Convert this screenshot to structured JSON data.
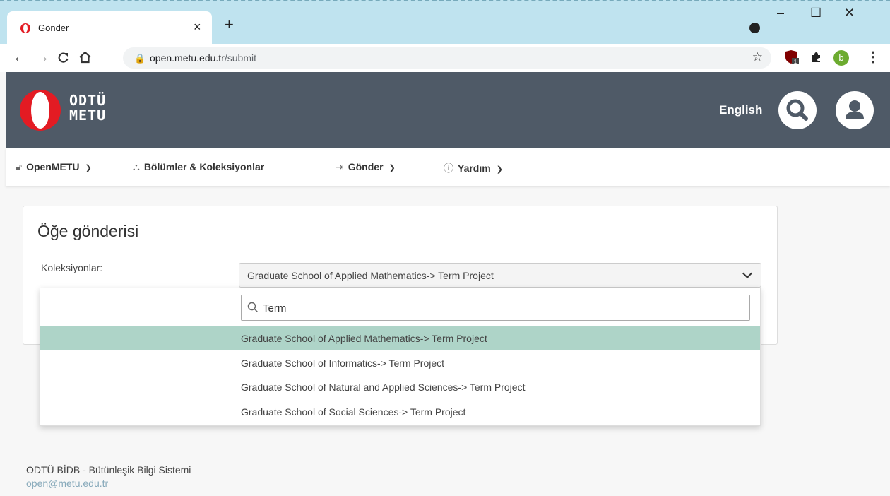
{
  "browser": {
    "tab_title": "Gönder",
    "tab_close": "×",
    "new_tab": "+",
    "url_host": "open.metu.edu.tr",
    "url_path": "/submit",
    "profile_initial": "b",
    "ext_badge": "1"
  },
  "header": {
    "logo_line1": "ODTÜ",
    "logo_line2": "METU",
    "language": "English"
  },
  "nav": {
    "items": [
      {
        "label": "OpenMETU",
        "icon": "unlock-icon"
      },
      {
        "label": "Bölümler & Koleksiyonlar",
        "icon": "sitemap-icon"
      },
      {
        "label": "Gönder",
        "icon": "sign-in-icon"
      },
      {
        "label": "Yardım",
        "icon": "info-icon"
      }
    ]
  },
  "form": {
    "title": "Öğe gönderisi",
    "collections_label": "Koleksiyonlar:",
    "selected_value": "Graduate School of Applied Mathematics-> Term Project"
  },
  "dropdown": {
    "search_value": "Term",
    "options": [
      "Graduate School of Applied Mathematics-> Term Project",
      "Graduate School of Informatics-> Term Project",
      "Graduate School of Natural and Applied Sciences-> Term Project",
      "Graduate School of Social Sciences-> Term Project"
    ],
    "highlighted_index": 0
  },
  "footer": {
    "line1": "ODTÜ BİDB - Bütünleşik Bilgi Sistemi",
    "email": "open@metu.edu.tr"
  },
  "colors": {
    "header_bg": "#4f5a67",
    "highlight": "#aed4c8",
    "logo_red": "#e31b23"
  }
}
